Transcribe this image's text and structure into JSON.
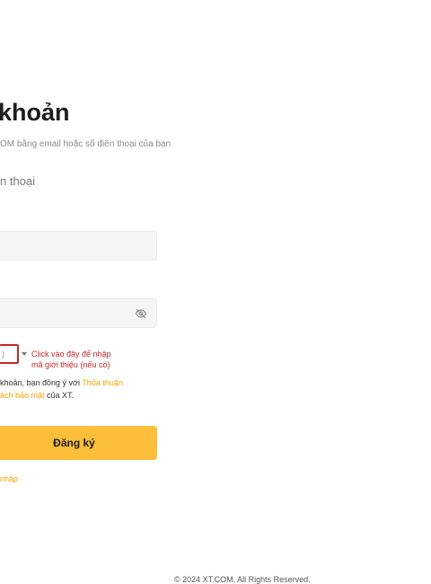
{
  "header": {
    "title": "khoản",
    "subtitle": "OM bằng email hoặc số điện thoại của bạn"
  },
  "tabs": {
    "phone_label": "n thoại"
  },
  "referral": {
    "selector_text": ")",
    "hint_line1": "Click vào đây để nhập",
    "hint_line2": "mã giới thiệu (nếu có)"
  },
  "agreement": {
    "line1_text": "khoản, bạn đồng ý với ",
    "line1_link": "Thỏa thuận",
    "line2_link": "ách bảo mật",
    "line2_text": " của XT."
  },
  "actions": {
    "register_label": "Đăng ký",
    "login_link": "nhập"
  },
  "footer": {
    "copyright": "© 2024 XT.COM. All Rights Reserved."
  },
  "colors": {
    "accent": "#fdbe39",
    "link": "#f0a500",
    "annotation": "#c62828"
  },
  "icons": {
    "password_toggle": "eye-slash-icon",
    "dropdown": "caret-down-icon"
  }
}
